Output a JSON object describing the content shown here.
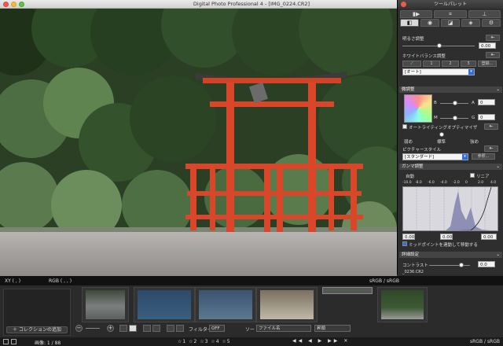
{
  "window": {
    "title": "Digital Photo Professional 4 - [IMG_0224.CR2]"
  },
  "coordbar": {
    "xy": "XY (          ,          )",
    "rgb": "RGB (          ,          ,          )",
    "profile": "sRGB / sRGB"
  },
  "palette": {
    "title": "ツールパレット",
    "tabs_row1": [
      "▮▶",
      "⌗",
      "⊥"
    ],
    "tabs_row2": [
      "◧",
      "◉",
      "◪",
      "◈",
      "⚙"
    ],
    "brightness": {
      "label": "明るさ調整",
      "value": "0.00"
    },
    "wb": {
      "label": "ホワイトバランス調整",
      "preset": "[オート]",
      "buttons": [
        "1",
        "2",
        "3",
        "登録..."
      ]
    },
    "color": {
      "label": "微調整",
      "b_label": "B",
      "m_label": "M",
      "a_label": "A",
      "g_label": "G",
      "a_value": "0",
      "g_value": "0"
    },
    "alo": {
      "label": "オートライティングオプティマイザ"
    },
    "strength": {
      "low": "弱め",
      "std": "標準",
      "high": "強め"
    },
    "picstyle": {
      "label": "ピクチャースタイル",
      "value": "[スタンダード]",
      "browse": "参照..."
    },
    "gamma": {
      "label": "ガンマ調整",
      "channel": "自動",
      "linear": "リニア",
      "ticks": [
        "-10.0",
        "-8.0",
        "-6.0",
        "-4.0",
        "-2.0",
        "0",
        "2.0",
        "4.0"
      ],
      "low": "0.00",
      "mid": "0.00",
      "high": "0.00",
      "midlink": "ミッドポイントを連動して移動する"
    },
    "detail": {
      "label": "詳細設定",
      "contrast_label": "コントラスト",
      "contrast_value": "0.0"
    }
  },
  "filmstrip": {
    "add_collection": "コレクションの追加",
    "filter_label": "フィルター",
    "filter_value": "OFF",
    "sort_label": "ソート",
    "sort_value": "ファイル名",
    "order_value": "昇順",
    "thumb_label": "_0236.CR2"
  },
  "statusbar": {
    "count": "画像: 1 / 88",
    "stars": "☆1 ☆2 ☆3 ☆4 ☆5",
    "nav": "◀◀ ◀ ▶ ▶▶ ✕",
    "profile": "sRGB / sRGB"
  }
}
